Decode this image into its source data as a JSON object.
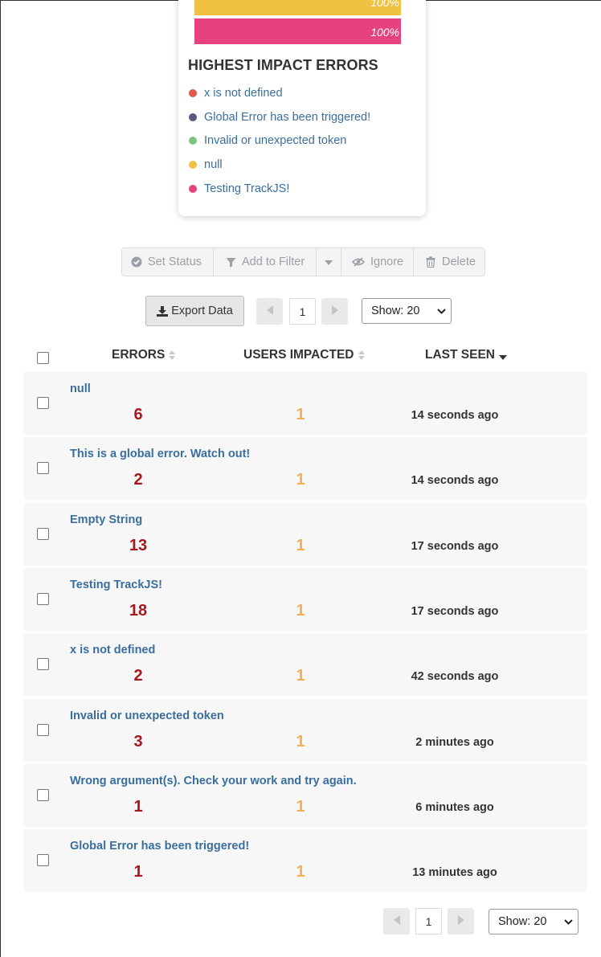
{
  "chart": {
    "bars": [
      {
        "label": "100%",
        "color": "#f0c242"
      },
      {
        "label": "100%",
        "color": "#e6437e"
      }
    ],
    "title": "HIGHEST IMPACT ERRORS",
    "legend": [
      {
        "label": "x is not defined",
        "color": "#e05a47"
      },
      {
        "label": "Global Error has been triggered!",
        "color": "#575b7e"
      },
      {
        "label": "Invalid or unexpected token",
        "color": "#7bc47f"
      },
      {
        "label": "null",
        "color": "#f0c242"
      },
      {
        "label": "Testing TrackJS!",
        "color": "#e6437e"
      }
    ]
  },
  "toolbar": {
    "set_status": "Set Status",
    "add_to_filter": "Add to Filter",
    "ignore": "Ignore",
    "delete": "Delete"
  },
  "pager": {
    "export_label": "Export Data",
    "page": "1",
    "show_label": "Show: 20"
  },
  "table": {
    "headers": {
      "errors": "ERRORS",
      "users": "USERS IMPACTED",
      "last_seen": "LAST SEEN"
    },
    "rows": [
      {
        "title": "null",
        "count": "6",
        "users": "1",
        "last_seen": "14 seconds ago"
      },
      {
        "title": "This is a global error. Watch out!",
        "count": "2",
        "users": "1",
        "last_seen": "14 seconds ago"
      },
      {
        "title": "Empty String",
        "count": "13",
        "users": "1",
        "last_seen": "17 seconds ago"
      },
      {
        "title": "Testing TrackJS!",
        "count": "18",
        "users": "1",
        "last_seen": "17 seconds ago"
      },
      {
        "title": "x is not defined",
        "count": "2",
        "users": "1",
        "last_seen": "42 seconds ago"
      },
      {
        "title": "Invalid or unexpected token",
        "count": "3",
        "users": "1",
        "last_seen": "2 minutes ago"
      },
      {
        "title": "Wrong argument(s). Check your work and try again.",
        "count": "1",
        "users": "1",
        "last_seen": "6 minutes ago"
      },
      {
        "title": "Global Error has been triggered!",
        "count": "1",
        "users": "1",
        "last_seen": "13 minutes ago"
      }
    ]
  }
}
